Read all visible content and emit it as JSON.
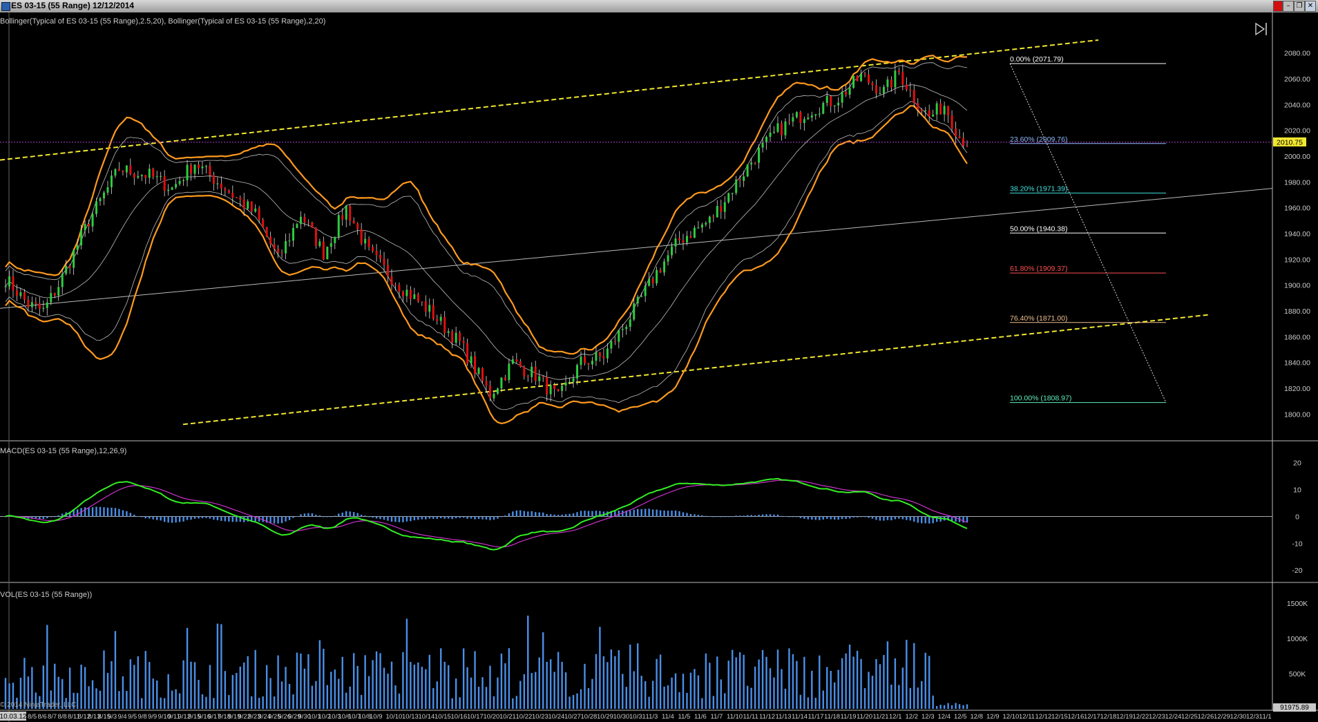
{
  "window": {
    "title": "ES 03-15 (55 Range)  12/12/2014",
    "close_glyph": "✕",
    "maximize_glyph": "❐",
    "minimize_glyph": "–"
  },
  "colors": {
    "background": "#000000",
    "candle_up": "#2ecc40",
    "candle_down": "#e01010",
    "bollinger_outer": "#ff9a1f",
    "bollinger_inner": "#bfbfbf",
    "channel": "#f2e830",
    "macd_line": "#33ee22",
    "macd_signal": "#cc33cc",
    "macd_histogram": "#4a8fe8",
    "volume": "#4a8fe8",
    "current_price_line": "#b040d0",
    "current_price_label": "#f2e830"
  },
  "price_panel": {
    "indicator_label": "Bollinger(Typical of ES 03-15 (55 Range),2.5,20), Bollinger(Typical of ES 03-15 (55 Range),2,20)",
    "axis_ticks": [
      "2080.00",
      "2060.00",
      "2040.00",
      "2020.00",
      "2000.00",
      "1980.00",
      "1960.00",
      "1940.00",
      "1920.00",
      "1900.00",
      "1880.00",
      "1860.00",
      "1840.00",
      "1820.00",
      "1800.00"
    ],
    "current_price": "2010.75",
    "fib_levels": [
      {
        "label": "0.00% (2071.79)",
        "price": 2071.79,
        "color": "#ffffff"
      },
      {
        "label": "23.60% (2009.76)",
        "price": 2009.76,
        "color": "#8fb8ff"
      },
      {
        "label": "38.20% (1971.39)",
        "price": 1971.39,
        "color": "#44e0e0"
      },
      {
        "label": "50.00% (1940.38)",
        "price": 1940.38,
        "color": "#ffffff"
      },
      {
        "label": "61.80% (1909.37)",
        "price": 1909.37,
        "color": "#ff5050"
      },
      {
        "label": "76.40% (1871.00)",
        "price": 1871.0,
        "color": "#f0c090"
      },
      {
        "label": "100.00% (1808.97)",
        "price": 1808.97,
        "color": "#60f0c0"
      }
    ],
    "skip_icon": "skip-to-end-icon"
  },
  "macd_panel": {
    "indicator_label": "MACD(ES 03-15 (55 Range),12,26,9)",
    "axis_ticks": [
      "20",
      "10",
      "0",
      "-10",
      "-20"
    ]
  },
  "volume_panel": {
    "indicator_label": "VOL(ES 03-15 (55 Range))",
    "axis_ticks": [
      "1500K",
      "1000K",
      "500K",
      "0"
    ],
    "current_volume": "91975.89"
  },
  "footer": {
    "copyright": "© 2014 NinjaTrader, LLC",
    "cursor_date": "10.03.12",
    "x_labels_dense": [
      "8/5",
      "8/6",
      "8/7",
      "8/8",
      "8/11",
      "8/12",
      "8/13",
      "8/15",
      "9/3",
      "9/4",
      "9/5",
      "9/8",
      "9/9",
      "9/10",
      "9/11",
      "9/12",
      "9/15",
      "9/16",
      "9/17",
      "9/18",
      "9/19",
      "9/22",
      "9/23",
      "9/24",
      "9/25",
      "9/26",
      "9/29",
      "9/30",
      "10/1",
      "10/2",
      "10/3",
      "10/6",
      "10/7",
      "10/8"
    ],
    "x_labels": [
      "10/9",
      "10/10",
      "10/13",
      "10/14",
      "10/15",
      "10/16",
      "10/17",
      "10/20",
      "10/21",
      "10/22",
      "10/23",
      "10/24",
      "10/27",
      "10/28",
      "10/29",
      "10/30",
      "10/31",
      "11/3",
      "11/4",
      "11/5",
      "11/6",
      "11/7",
      "11/10",
      "11/11",
      "11/12",
      "11/13",
      "11/14",
      "11/17",
      "11/18",
      "11/19",
      "11/20",
      "11/21",
      "12/1",
      "12/2",
      "12/3",
      "12/4",
      "12/5",
      "12/8",
      "12/9",
      "12/10",
      "12/11",
      "12/12",
      "12/15",
      "12/16",
      "12/17",
      "12/18",
      "12/19",
      "12/22",
      "12/23",
      "12/24",
      "12/25",
      "12/26",
      "12/29",
      "12/30",
      "12/31",
      "1/1"
    ]
  },
  "chart_data": {
    "type": "candlestick",
    "title": "ES 03-15 (55 Range)  12/12/2014",
    "panels": [
      "price",
      "macd",
      "volume"
    ],
    "price_range": [
      1790,
      2090
    ],
    "macd_range": [
      -22,
      23
    ],
    "volume_range": [
      0,
      1550000
    ],
    "price_path_anchors": [
      {
        "i": 0,
        "p": 1905
      },
      {
        "i": 6,
        "p": 1885
      },
      {
        "i": 10,
        "p": 1880
      },
      {
        "i": 14,
        "p": 1900
      },
      {
        "i": 22,
        "p": 1950
      },
      {
        "i": 30,
        "p": 1990
      },
      {
        "i": 38,
        "p": 1985
      },
      {
        "i": 44,
        "p": 1975
      },
      {
        "i": 50,
        "p": 1995
      },
      {
        "i": 58,
        "p": 1975
      },
      {
        "i": 66,
        "p": 1955
      },
      {
        "i": 72,
        "p": 1920
      },
      {
        "i": 78,
        "p": 1955
      },
      {
        "i": 84,
        "p": 1925
      },
      {
        "i": 90,
        "p": 1960
      },
      {
        "i": 96,
        "p": 1925
      },
      {
        "i": 104,
        "p": 1900
      },
      {
        "i": 112,
        "p": 1880
      },
      {
        "i": 120,
        "p": 1855
      },
      {
        "i": 128,
        "p": 1815
      },
      {
        "i": 134,
        "p": 1840
      },
      {
        "i": 140,
        "p": 1830
      },
      {
        "i": 146,
        "p": 1812
      },
      {
        "i": 152,
        "p": 1840
      },
      {
        "i": 158,
        "p": 1845
      },
      {
        "i": 166,
        "p": 1880
      },
      {
        "i": 172,
        "p": 1910
      },
      {
        "i": 178,
        "p": 1935
      },
      {
        "i": 186,
        "p": 1950
      },
      {
        "i": 192,
        "p": 1975
      },
      {
        "i": 198,
        "p": 2000
      },
      {
        "i": 204,
        "p": 2020
      },
      {
        "i": 212,
        "p": 2035
      },
      {
        "i": 220,
        "p": 2045
      },
      {
        "i": 226,
        "p": 2062
      },
      {
        "i": 232,
        "p": 2050
      },
      {
        "i": 236,
        "p": 2065
      },
      {
        "i": 240,
        "p": 2045
      },
      {
        "i": 244,
        "p": 2030
      },
      {
        "i": 248,
        "p": 2040
      },
      {
        "i": 252,
        "p": 2015
      },
      {
        "i": 254,
        "p": 2010.75
      }
    ],
    "bar_count": 255,
    "last_price": 2010.75,
    "fib_retracement": {
      "high": 2071.79,
      "low": 1808.97
    }
  }
}
